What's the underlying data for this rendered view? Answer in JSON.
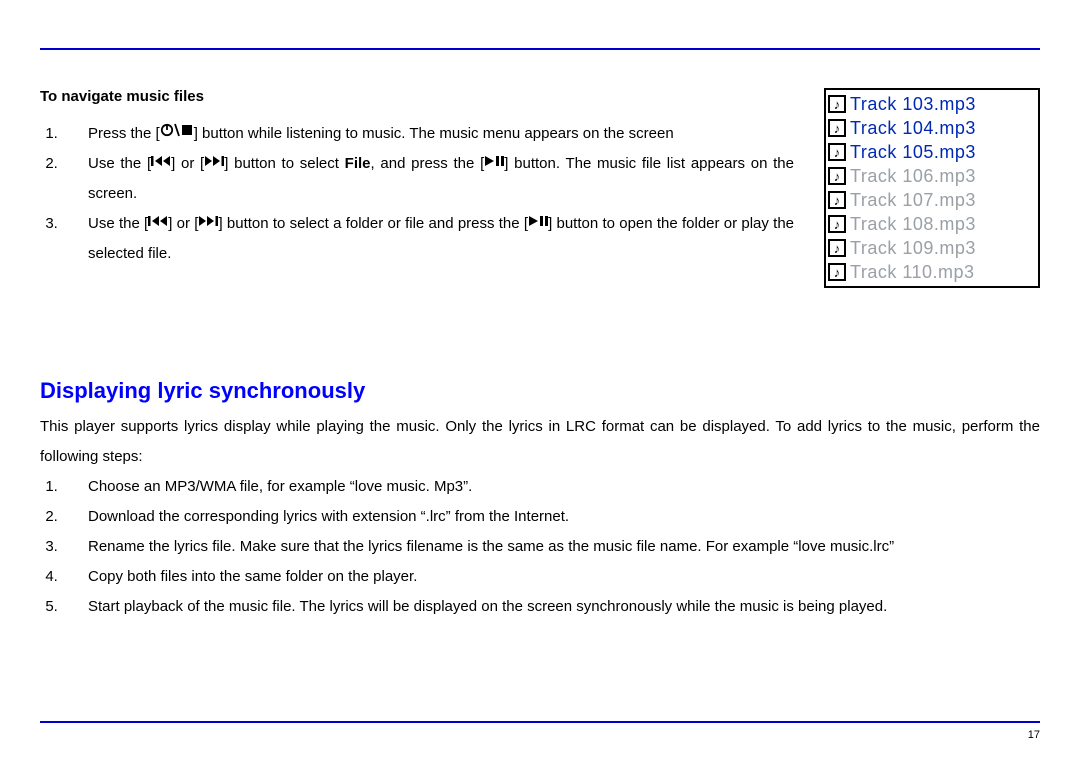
{
  "section1": {
    "heading": "To navigate music files",
    "steps": [
      {
        "before": "Press the [",
        "icon": "power-stop",
        "after": "] button while listening to music. The music menu appears on the screen"
      },
      {
        "seg1": "Use the [",
        "icon1": "skip-back",
        "seg2": "] or [",
        "icon2": "skip-forward",
        "seg3": "] button to select ",
        "bold": "File",
        "seg4": ", and press the [",
        "icon3": "play-pause",
        "seg5": "] button. The music file list appears on the screen."
      },
      {
        "seg1": "Use the [",
        "icon1": "skip-back",
        "seg2": "] or [",
        "icon2": "skip-forward",
        "seg3": "] button to select a folder or file and press the [",
        "icon3": "play-pause",
        "seg4": "] button to open the folder or play the selected file."
      }
    ]
  },
  "tracklist": [
    {
      "label": "Track 103.mp3",
      "highlight": true
    },
    {
      "label": "Track 104.mp3",
      "highlight": true
    },
    {
      "label": "Track 105.mp3",
      "highlight": true
    },
    {
      "label": "Track 106.mp3",
      "highlight": false
    },
    {
      "label": "Track 107.mp3",
      "highlight": false
    },
    {
      "label": "Track 108.mp3",
      "highlight": false
    },
    {
      "label": "Track 109.mp3",
      "highlight": false
    },
    {
      "label": "Track 110.mp3",
      "highlight": false
    }
  ],
  "section2": {
    "title": "Displaying lyric synchronously",
    "intro": "This player supports lyrics display while playing the music. Only the lyrics in LRC format can be displayed. To add lyrics to the music, perform the following steps:",
    "steps": [
      "Choose an MP3/WMA file, for example “love music. Mp3”.",
      "Download the corresponding lyrics with extension “.lrc” from the Internet.",
      "Rename the lyrics file. Make sure that the lyrics filename is the same as the music file name. For example “love music.lrc”",
      "Copy both files into the same folder on the player.",
      "Start playback of the music file. The lyrics will be displayed on the screen synchronously while the music is being played."
    ]
  },
  "page_number": "17",
  "icons": {
    "note_glyph": "♪"
  }
}
